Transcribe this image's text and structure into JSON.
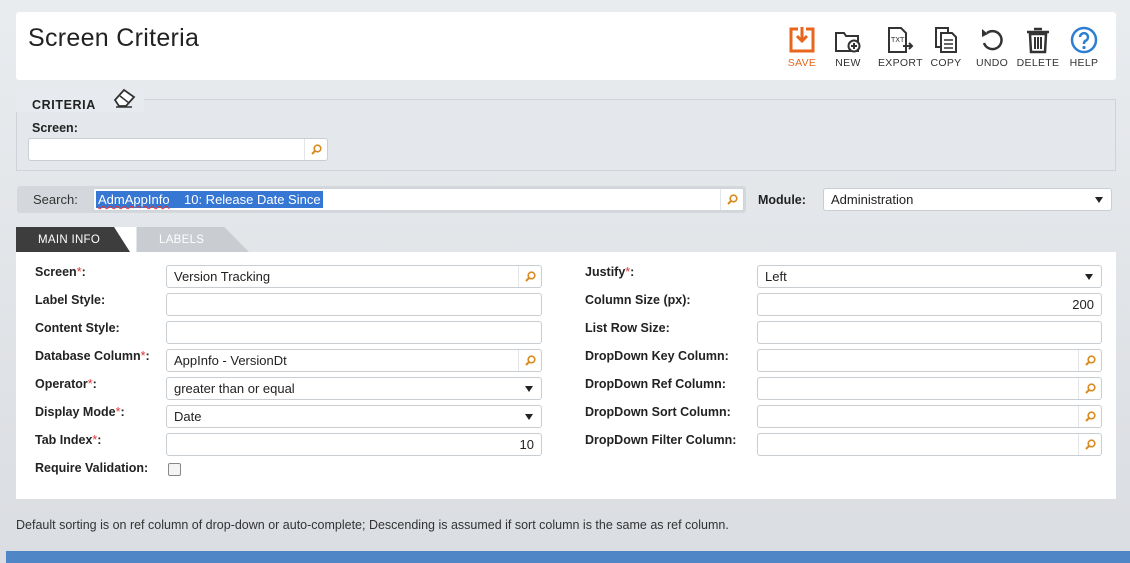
{
  "page": {
    "title": "Screen Criteria"
  },
  "toolbar": {
    "save": "SAVE",
    "new": "NEW",
    "export": "EXPORT",
    "export_badge": "TXT",
    "copy": "COPY",
    "undo": "UNDO",
    "delete": "DELETE",
    "help": "HELP",
    "accent_color": "#e8661c",
    "help_color": "#2f7fd1"
  },
  "criteria": {
    "legend": "CRITERIA",
    "screen_label": "Screen:",
    "screen_value": ""
  },
  "search": {
    "label": "Search:",
    "value_code": "AdmAppInfo",
    "value_rest": "    10: Release Date Since",
    "module_label": "Module:",
    "module_value": "Administration"
  },
  "tabs": {
    "main": "MAIN INFO",
    "labels": "LABELS"
  },
  "form": {
    "screen_label": "Screen",
    "screen_value": "Version Tracking",
    "label_style_label": "Label Style:",
    "label_style_value": "",
    "content_style_label": "Content Style:",
    "content_style_value": "",
    "db_column_label": "Database Column",
    "db_column_value": "AppInfo - VersionDt",
    "operator_label": "Operator",
    "operator_value": "greater than or equal",
    "display_mode_label": "Display Mode",
    "display_mode_value": "Date",
    "tab_index_label": "Tab Index",
    "tab_index_value": "10",
    "require_validation_label": "Require Validation:",
    "justify_label": "Justify",
    "justify_value": "Left",
    "column_size_label": "Column Size (px):",
    "column_size_value": "200",
    "list_row_size_label": "List Row Size:",
    "list_row_size_value": "",
    "dd_key_label": "DropDown Key Column:",
    "dd_key_value": "",
    "dd_ref_label": "DropDown Ref Column:",
    "dd_ref_value": "",
    "dd_sort_label": "DropDown Sort Column:",
    "dd_sort_value": "",
    "dd_filter_label": "DropDown Filter Column:",
    "dd_filter_value": "",
    "required_mark": "*",
    "colon": ":"
  },
  "footnote": "Default sorting is on ref column of drop-down or auto-complete; Descending is assumed if sort column is the same as ref column."
}
